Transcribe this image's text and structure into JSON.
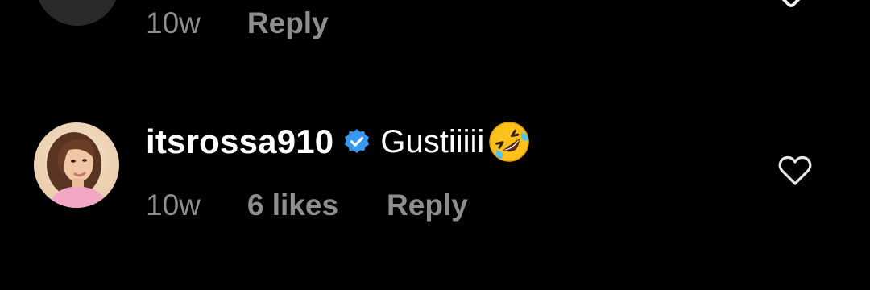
{
  "previous_comment": {
    "time": "10w",
    "reply_label": "Reply"
  },
  "comment": {
    "username": "itsrossa910",
    "verified": true,
    "text": "Gustiiiii",
    "emoji": "rolling-on-the-floor-laughing",
    "time": "10w",
    "likes": "6 likes",
    "reply_label": "Reply"
  },
  "colors": {
    "background": "#000000",
    "primary_text": "#ffffff",
    "secondary_text": "#8e8e8e",
    "verified_badge": "#3897f0"
  },
  "icons": {
    "verified": "verified-badge-icon",
    "like": "heart-outline-icon"
  }
}
